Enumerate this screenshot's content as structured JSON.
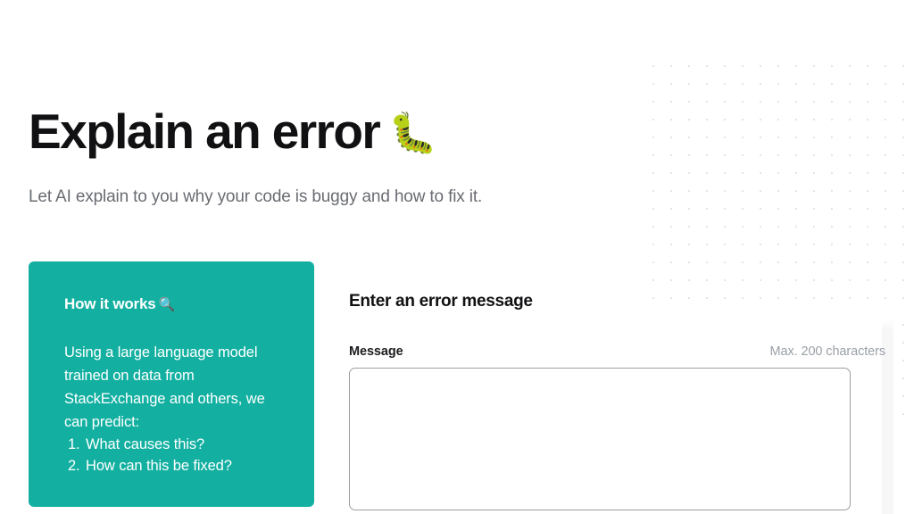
{
  "hero": {
    "title": "Explain an error",
    "title_emoji": "🐛",
    "title_emoji_name": "caterpillar-emoji",
    "subtitle": "Let AI explain to you why your code is buggy and how to fix it."
  },
  "how_it_works": {
    "title": "How it works",
    "title_emoji": "🔍",
    "title_emoji_name": "magnifying-glass-emoji",
    "body": "Using a large language model trained on data from StackExchange and others, we can predict:",
    "items": [
      "What causes this?",
      "How can this be fixed?"
    ]
  },
  "form": {
    "heading": "Enter an error message",
    "label": "Message",
    "hint": "Max. 200 characters",
    "textarea_value": "",
    "textarea_placeholder": ""
  },
  "colors": {
    "accent_teal": "#13b0a1",
    "title_black": "#111113",
    "subtitle_gray": "#696c72",
    "hint_gray": "#9aa0a6",
    "dot_gray": "#e4e4e6",
    "border_gray": "#9b9ea3"
  }
}
